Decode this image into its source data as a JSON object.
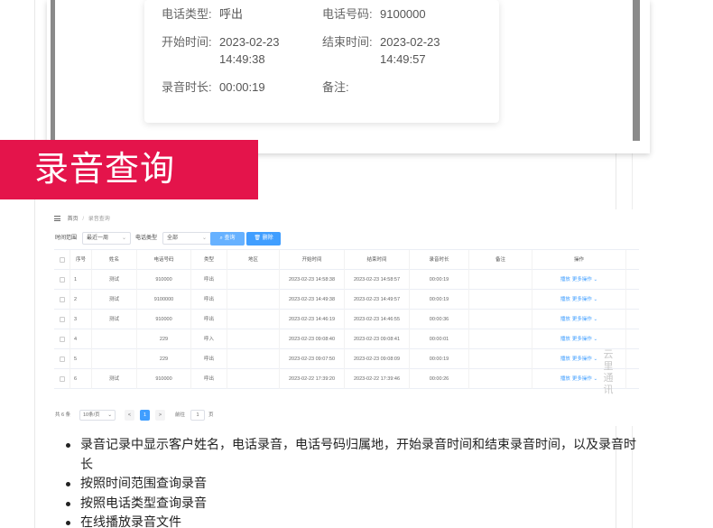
{
  "detail": {
    "call_type_label": "电话类型:",
    "call_type_value": "呼出",
    "phone_label": "电话号码:",
    "phone_value": "9100000",
    "start_label": "开始时间:",
    "start_date": "2023-02-23",
    "start_time": "14:49:38",
    "end_label": "结束时间:",
    "end_date": "2023-02-23",
    "end_time": "14:49:57",
    "duration_label": "录音时长:",
    "duration_value": "00:00:19",
    "note_label": "备注:"
  },
  "banner": {
    "title": "录音查询"
  },
  "breadcrumb": {
    "home": "首页",
    "current": "录音查询"
  },
  "filters": {
    "time_range_label": "时间范围",
    "time_range_value": "最近一周",
    "call_type_label": "电话类型",
    "call_type_value": "全部",
    "search_label": "查询",
    "delete_label": "删除"
  },
  "table": {
    "headers": [
      "序号",
      "姓名",
      "电话号码",
      "类型",
      "地区",
      "开始时间",
      "结束时间",
      "录音时长",
      "备注",
      "操作"
    ],
    "rows": [
      {
        "no": "1",
        "name": "测试",
        "phone": "910000",
        "type": "呼出",
        "region": "",
        "start": "2023-02-23 14:58:38",
        "end": "2023-02-23 14:58:57",
        "duration": "00:00:19",
        "note": ""
      },
      {
        "no": "2",
        "name": "测试",
        "phone": "9100000",
        "type": "呼出",
        "region": "",
        "start": "2023-02-23 14:49:38",
        "end": "2023-02-23 14:49:57",
        "duration": "00:00:19",
        "note": ""
      },
      {
        "no": "3",
        "name": "测试",
        "phone": "910000",
        "type": "呼出",
        "region": "",
        "start": "2023-02-23 14:46:19",
        "end": "2023-02-23 14:46:55",
        "duration": "00:00:36",
        "note": ""
      },
      {
        "no": "4",
        "name": "",
        "phone": "229",
        "type": "呼入",
        "region": "",
        "start": "2023-02-23 09:08:40",
        "end": "2023-02-23 09:08:41",
        "duration": "00:00:01",
        "note": ""
      },
      {
        "no": "5",
        "name": "",
        "phone": "229",
        "type": "呼出",
        "region": "",
        "start": "2023-02-23 09:07:50",
        "end": "2023-02-23 09:08:09",
        "duration": "00:00:19",
        "note": ""
      },
      {
        "no": "6",
        "name": "测试",
        "phone": "910000",
        "type": "呼出",
        "region": "",
        "start": "2023-02-22 17:39:20",
        "end": "2023-02-22 17:39:46",
        "duration": "00:00:26",
        "note": ""
      }
    ],
    "op_play": "播放",
    "op_more": "更多操作"
  },
  "pager": {
    "total": "共 6 条",
    "page_size": "10条/页",
    "prev": "<",
    "page": "1",
    "next": ">",
    "goto_label": "前往",
    "goto_value": "1",
    "page_unit": "页"
  },
  "watermark": {
    "text": "云里通讯"
  },
  "features": [
    "录音记录中显示客户姓名，电话录音，电话号码归属地，开始录音时间和结束录音时间，以及录音时长",
    "按照时间范围查询录音",
    "按照电话类型查询录音",
    "在线播放录音文件"
  ],
  "colors": {
    "banner": "#e4144b",
    "primary": "#409eff"
  }
}
